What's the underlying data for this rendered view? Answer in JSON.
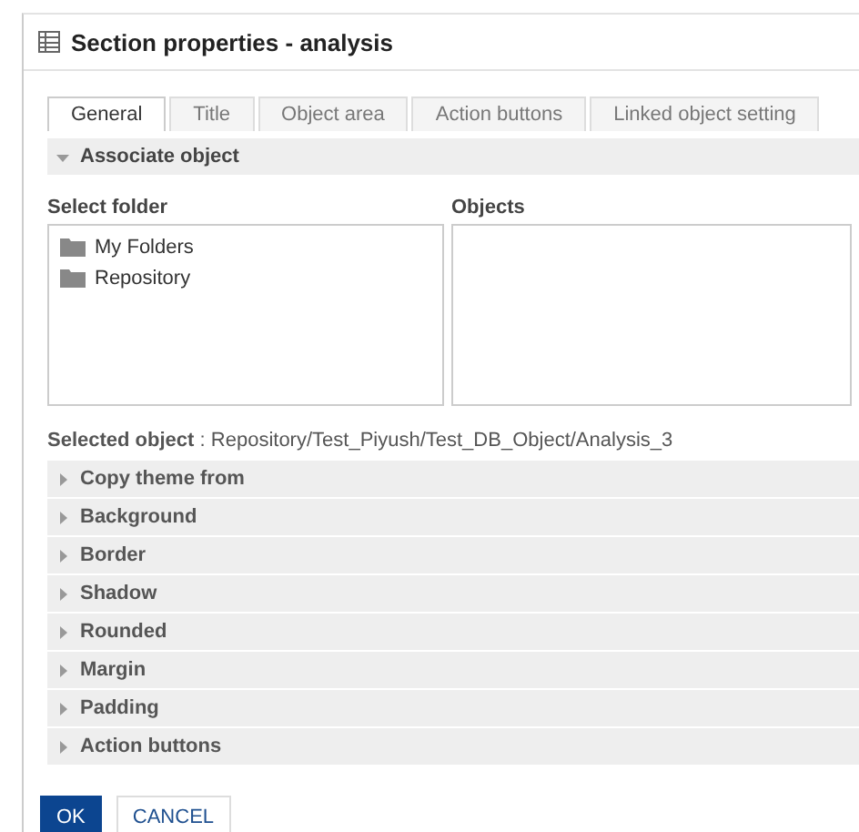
{
  "window": {
    "title": "Section properties - analysis"
  },
  "tabs": [
    {
      "label": "General",
      "selected": true
    },
    {
      "label": "Title",
      "selected": false
    },
    {
      "label": "Object area",
      "selected": false
    },
    {
      "label": "Action buttons",
      "selected": false
    },
    {
      "label": "Linked object setting",
      "selected": false
    }
  ],
  "associate": {
    "title": "Associate object",
    "expanded": true,
    "folder_label": "Select folder",
    "objects_label": "Objects",
    "folders": [
      {
        "label": "My Folders"
      },
      {
        "label": "Repository"
      }
    ],
    "selected_label": "Selected object",
    "selected_sep": ":",
    "selected_value": "Repository/Test_Piyush/Test_DB_Object/Analysis_3"
  },
  "sections": [
    {
      "title": "Copy theme from",
      "expanded": false
    },
    {
      "title": "Background",
      "expanded": false
    },
    {
      "title": "Border",
      "expanded": false
    },
    {
      "title": "Shadow",
      "expanded": false
    },
    {
      "title": "Rounded",
      "expanded": false
    },
    {
      "title": "Margin",
      "expanded": false
    },
    {
      "title": "Padding",
      "expanded": false
    },
    {
      "title": "Action buttons",
      "expanded": false
    }
  ],
  "buttons": [
    {
      "label": "OK",
      "kind": "primary"
    },
    {
      "label": "CANCEL",
      "kind": "secondary"
    }
  ]
}
